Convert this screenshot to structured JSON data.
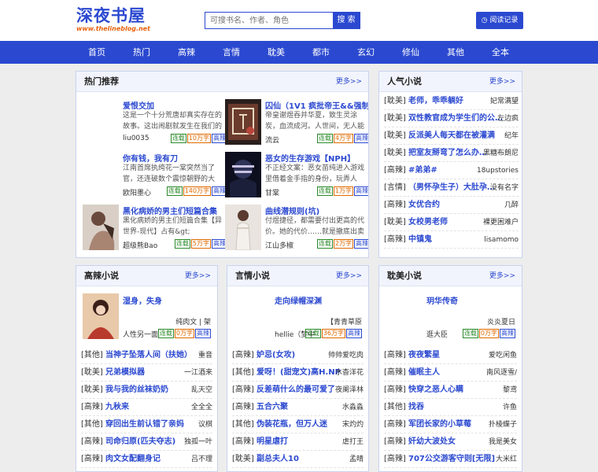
{
  "header": {
    "logo": "深夜书屋",
    "logo_sub": "www.thelineblog.net",
    "search_placeholder": "可搜书名、作者、角色",
    "search_button": "搜 索",
    "history_button": "阅读记录"
  },
  "nav": [
    "首页",
    "热门",
    "高辣",
    "言情",
    "耽美",
    "都市",
    "玄幻",
    "修仙",
    "其他",
    "全本"
  ],
  "hot": {
    "title": "热门推荐",
    "more": "更多>>",
    "items": [
      {
        "title": "爱恨交加",
        "desc": "这是一个十分荒唐却真实存在的故事。这出闹剧就发生在我们的",
        "author": "liu0035",
        "tags": [
          "连载",
          "10万字",
          "高辣"
        ]
      },
      {
        "title": "囚仙（1V1 疯批帝王&&强制…",
        "desc": "帝皇谢煜吞并华夏，致生灵涂炭，血流成河。人世间，无人能",
        "author": "流云",
        "tags": [
          "连载",
          "4万字",
          "高辣"
        ]
      },
      {
        "title": "你有钱，我有刀",
        "desc": "江南首席执绔花一棠突然当了官，还连破数个震惊朝野的大",
        "author": "欧阳墨心",
        "tags": [
          "连载",
          "140万字",
          "高辣"
        ]
      },
      {
        "title": "恶女的生存游戏【NPH】",
        "desc": "不正经文案：恶女苗纯进入游戏里借着金手指的身份，玩弄人",
        "author": "甘棠",
        "tags": [
          "连载",
          "1万字",
          "高辣"
        ]
      },
      {
        "title": "黑化病娇的男主们短篇合集",
        "desc": "黑化病娇的男主们短篇合集【异世界-现代】占有&gt;",
        "author": "超级熊Bao",
        "tags": [
          "连载",
          "5万字",
          "高辣"
        ]
      },
      {
        "title": "曲线潜规则(坑)",
        "desc": "付煜捷径，都需要付出更高的代价。她的代价……就是撤底出卖",
        "author": "江山多椒",
        "tags": [
          "连载",
          "2万字",
          "高辣"
        ]
      }
    ]
  },
  "popular": {
    "title": "人气小说",
    "more": "更多>>",
    "rows": [
      {
        "cat": "[耽美]",
        "title": "老师，乖乖躺好",
        "author": "妃常满望"
      },
      {
        "cat": "[耽美]",
        "title": "双性教官成为学生们的公…",
        "author": "左边疯"
      },
      {
        "cat": "[耽美]",
        "title": "反派美人每天都在被灌满",
        "author": "纪年"
      },
      {
        "cat": "[耽美]",
        "title": "把室友掰弯了怎么办…",
        "author": "黑糖布朗尼"
      },
      {
        "cat": "[高辣]",
        "title": "#弟弟#",
        "author": "18upstories"
      },
      {
        "cat": "[言情]",
        "title": "（男怀孕生子）大肚孕…",
        "author": "没有名字"
      },
      {
        "cat": "[高辣]",
        "title": "女优合约",
        "author": "几醉"
      },
      {
        "cat": "[耽美]",
        "title": "女校男老师",
        "author": "裸更困难户"
      },
      {
        "cat": "[高辣]",
        "title": "中镇鬼",
        "author": "lisamomo"
      }
    ]
  },
  "gaola": {
    "title": "高辣小说",
    "more": "更多>>",
    "featured": {
      "title": "湿身，失身",
      "line1": "纯肉文 | 架",
      "line2": "人性另一面",
      "tags": [
        "连载",
        "0万字",
        "高辣"
      ]
    },
    "rows": [
      {
        "cat": "[其他]",
        "title": "当神子坠落人间（扶她）",
        "author": "重音"
      },
      {
        "cat": "[耽美]",
        "title": "兄弟模拟器",
        "author": "一江酒来"
      },
      {
        "cat": "[耽美]",
        "title": "我与我的丝袜奶奶",
        "author": "乱天空"
      },
      {
        "cat": "[高辣]",
        "title": "九秋来",
        "author": "全全全"
      },
      {
        "cat": "[其他]",
        "title": "穿回出生前认错了亲妈",
        "author": "议棋"
      },
      {
        "cat": "[高辣]",
        "title": "司命归原(匹夫夺志)",
        "author": "独孤一叶"
      },
      {
        "cat": "[高辣]",
        "title": "肉文女配翻身记",
        "author": "吕不理"
      }
    ]
  },
  "yanqing": {
    "title": "言情小说",
    "more": "更多>>",
    "featured": {
      "title": "走向绿帽深渊",
      "line1": "【青青草原",
      "line2": "hellie（梦中",
      "tags": [
        "连载",
        "36万字",
        "高辣"
      ]
    },
    "rows": [
      {
        "cat": "[高辣]",
        "title": "妒忌(女攻)",
        "author": "帅帅爱吃肉"
      },
      {
        "cat": "[其他]",
        "title": "爱呀！(甜宠文)高H.NP",
        "author": "水杳洋花"
      },
      {
        "cat": "[高辣]",
        "title": "反差萌什么的最可爱了",
        "author": "夜阑泽林"
      },
      {
        "cat": "[高辣]",
        "title": "五合六聚",
        "author": "水淼淼"
      },
      {
        "cat": "[其他]",
        "title": "伪装花瓶，但万人迷",
        "author": "宋灼灼"
      },
      {
        "cat": "[高辣]",
        "title": "明星虐打",
        "author": "虐打王"
      },
      {
        "cat": "[耽美]",
        "title": "副总夫人10",
        "author": "孟晴"
      }
    ]
  },
  "danmei": {
    "title": "耽美小说",
    "more": "更多>>",
    "featured": {
      "title": "玥华传奇",
      "line1": "炎炎夏日",
      "line2": "逛大臣",
      "tags": [
        "连载",
        "0万字",
        "高辣"
      ]
    },
    "rows": [
      {
        "cat": "[高辣]",
        "title": "夜夜繁星",
        "author": "爱吃闲鱼"
      },
      {
        "cat": "[高辣]",
        "title": "催眠主人",
        "author": "南风逐雪/"
      },
      {
        "cat": "[高辣]",
        "title": "快穿之恶人心瞒",
        "author": "黎鸢"
      },
      {
        "cat": "[其他]",
        "title": "找吞",
        "author": "许鱼"
      },
      {
        "cat": "[高辣]",
        "title": "军团长家的小草莓",
        "author": "扑棱蝶子"
      },
      {
        "cat": "[高辣]",
        "title": "奸幼大波处女",
        "author": "我是美女"
      },
      {
        "cat": "[高辣]",
        "title": "707公交游客守则[无限]",
        "author": "大米红"
      }
    ]
  },
  "colors": {
    "accent": "#2b49d0",
    "nav": "#2b49d0",
    "logo_sub": "#e8610c",
    "tag_green": "#2a8a2a",
    "tag_orange": "#e06a00"
  }
}
